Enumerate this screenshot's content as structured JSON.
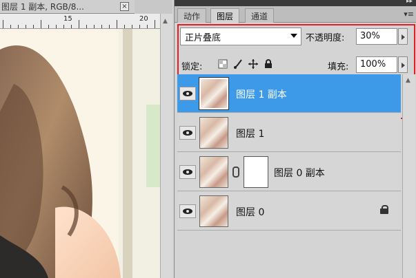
{
  "document": {
    "tab_title": "图层 1 副本, RGB/8...",
    "close_glyph": "×",
    "ruler_numbers": [
      "15",
      "20"
    ]
  },
  "panel": {
    "tabs": [
      {
        "label": "动作",
        "active": false
      },
      {
        "label": "图层",
        "active": true
      },
      {
        "label": "通道",
        "active": false
      }
    ],
    "blend_mode": "正片叠底",
    "opacity_label": "不透明度:",
    "opacity_value": "30%",
    "lock_label": "锁定:",
    "fill_label": "填充:",
    "fill_value": "100%",
    "layers": [
      {
        "name": "图层 1 副本",
        "selected": true,
        "mask": false,
        "locked": false
      },
      {
        "name": "图层 1",
        "selected": false,
        "mask": false,
        "locked": false
      },
      {
        "name": "图层 0 副本",
        "selected": false,
        "mask": true,
        "locked": false
      },
      {
        "name": "图层 0",
        "selected": false,
        "mask": false,
        "locked": true
      }
    ]
  },
  "colors": {
    "selection": "#3d9ae8",
    "highlight_box": "#e11d25"
  }
}
